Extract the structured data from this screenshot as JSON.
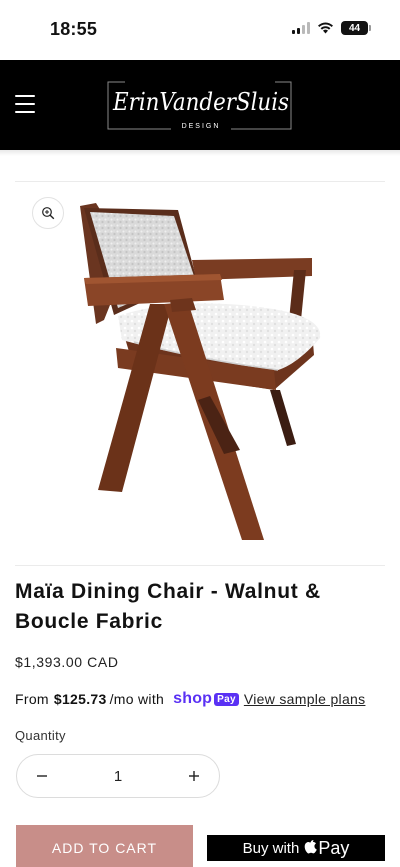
{
  "status_bar": {
    "time": "18:55",
    "battery": "44"
  },
  "header": {
    "logo_script": "ErinVanderSluis",
    "logo_sub": "DESIGN"
  },
  "product": {
    "title": "Maïa Dining Chair - Walnut & Boucle Fabric",
    "price": "$1,393.00 CAD",
    "installments": {
      "prefix": "From",
      "amount": "$125.73",
      "suffix": "/mo with",
      "shop_word": "shop",
      "pay_word": "Pay",
      "link": "View sample plans"
    },
    "quantity_label": "Quantity",
    "quantity_value": "1",
    "add_to_cart": "ADD TO CART",
    "buy_with": "Buy with",
    "apple_pay": "Pay"
  },
  "colors": {
    "header_bg": "#000000",
    "add_to_cart_bg": "#c88e89",
    "shop_pay_purple": "#5a31f4",
    "buy_button_bg": "#000000"
  },
  "icons": {
    "menu": "hamburger-icon",
    "zoom": "zoom-in-icon",
    "decrease": "minus-icon",
    "increase": "plus-icon",
    "apple": "apple-icon"
  }
}
